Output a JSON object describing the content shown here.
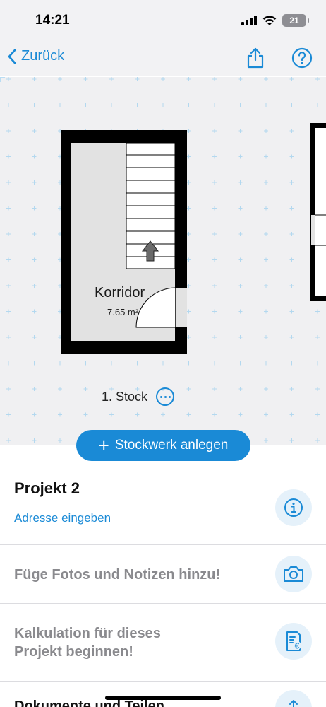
{
  "status_bar": {
    "time": "14:21",
    "battery": "21"
  },
  "nav": {
    "back_label": "Zurück"
  },
  "floorplan": {
    "room_name": "Korridor",
    "room_area": "7.65 m²",
    "floor_name": "1. Stock"
  },
  "add_floor_button": {
    "label": "Stockwerk anlegen"
  },
  "project": {
    "title": "Projekt 2",
    "address_link": "Adresse eingeben"
  },
  "rows": {
    "photos": "Füge Fotos und Notizen hinzu!",
    "calc_line1": "Kalkulation für dieses",
    "calc_line2": "Projekt beginnen!",
    "docs": "Dokumente und Teilen"
  },
  "colors": {
    "accent": "#1a8ad6",
    "muted_text": "#8a8a8e",
    "icon_circle": "#e5f1fa"
  }
}
